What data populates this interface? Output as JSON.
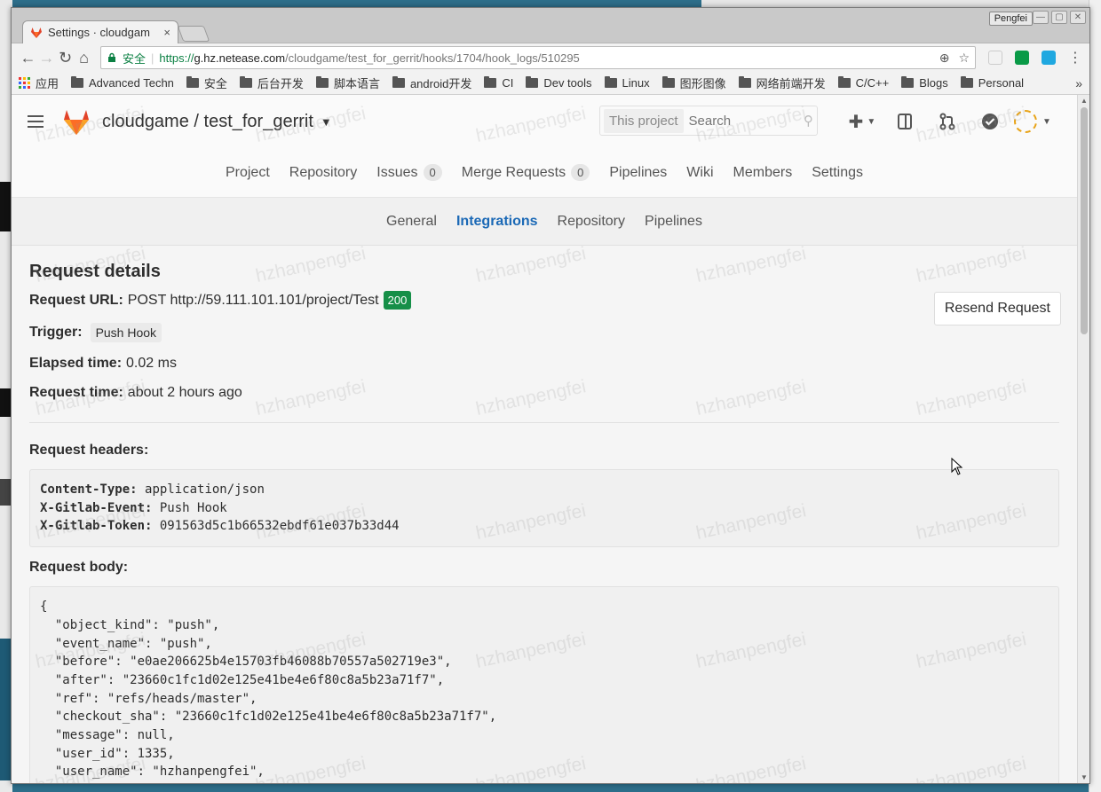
{
  "browser": {
    "tab_title": "Settings · cloudgam",
    "tab_close": "×",
    "user_badge": "Pengfei",
    "secure_label": "安全",
    "url_scheme": "https://",
    "url_host": "g.hz.netease.com",
    "url_path": "/cloudgame/test_for_gerrit/hooks/1704/hook_logs/510295",
    "bookmarks": [
      "应用",
      "Advanced Techn",
      "安全",
      "后台开发",
      "脚本语言",
      "android开发",
      "CI",
      "Dev tools",
      "Linux",
      "图形图像",
      "网络前端开发",
      "C/C++",
      "Blogs",
      "Personal"
    ],
    "bookmarks_more": "»"
  },
  "header": {
    "project_path": "cloudgame / test_for_gerrit",
    "search_scope": "This project",
    "search_placeholder": "Search"
  },
  "project_nav": [
    {
      "label": "Project"
    },
    {
      "label": "Repository"
    },
    {
      "label": "Issues",
      "count": "0"
    },
    {
      "label": "Merge Requests",
      "count": "0"
    },
    {
      "label": "Pipelines"
    },
    {
      "label": "Wiki"
    },
    {
      "label": "Members"
    },
    {
      "label": "Settings"
    }
  ],
  "settings_nav": [
    {
      "label": "General"
    },
    {
      "label": "Integrations",
      "active": true
    },
    {
      "label": "Repository"
    },
    {
      "label": "Pipelines"
    }
  ],
  "request": {
    "title": "Request details",
    "url_label": "Request URL:",
    "url_value": "POST http://59.111.101.101/project/Test",
    "status_code": "200",
    "trigger_label": "Trigger:",
    "trigger_value": "Push Hook",
    "elapsed_label": "Elapsed time:",
    "elapsed_value": "0.02 ms",
    "time_label": "Request time:",
    "time_value": "about 2 hours ago",
    "resend_label": "Resend Request",
    "headers_label": "Request headers:",
    "headers": [
      {
        "key": "Content-Type:",
        "value": "application/json"
      },
      {
        "key": "X-Gitlab-Event:",
        "value": "Push Hook"
      },
      {
        "key": "X-Gitlab-Token:",
        "value": "091563d5c1b66532ebdf61e037b33d44"
      }
    ],
    "body_label": "Request body:",
    "body_lines": [
      "{",
      "  \"object_kind\": \"push\",",
      "  \"event_name\": \"push\",",
      "  \"before\": \"e0ae206625b4e15703fb46088b70557a502719e3\",",
      "  \"after\": \"23660c1fc1d02e125e41be4e6f80c8a5b23a71f7\",",
      "  \"ref\": \"refs/heads/master\",",
      "  \"checkout_sha\": \"23660c1fc1d02e125e41be4e6f80c8a5b23a71f7\",",
      "  \"message\": null,",
      "  \"user_id\": 1335,",
      "  \"user_name\": \"hzhanpengfei\","
    ]
  },
  "watermark_text": "hzhanpengfei"
}
